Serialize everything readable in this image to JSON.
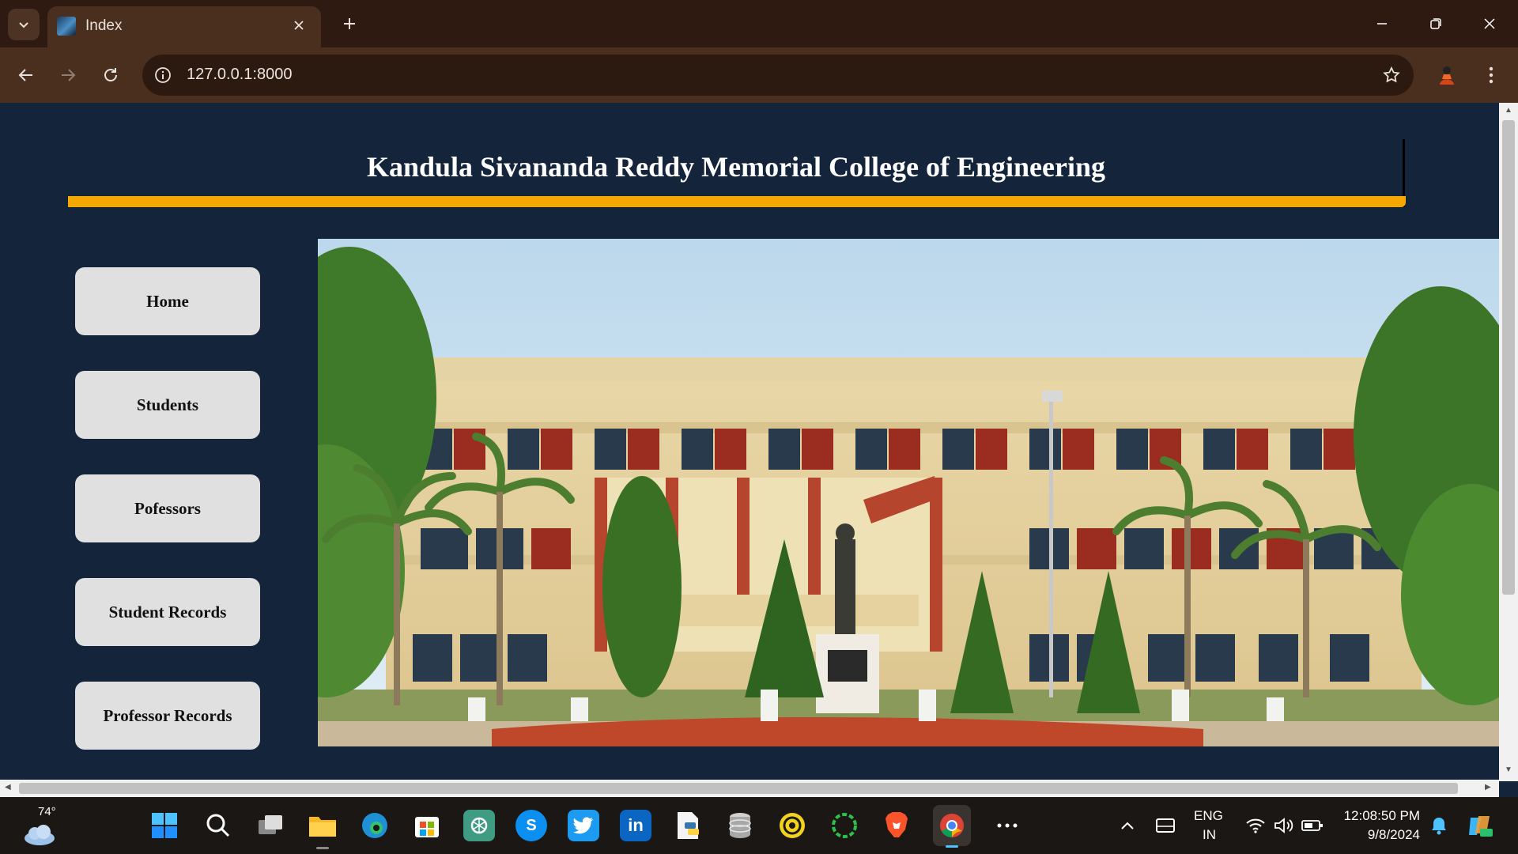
{
  "browser": {
    "tab_title": "Index",
    "url": "127.0.0.1:8000"
  },
  "page": {
    "title": "Kandula Sivananda Reddy Memorial College of Engineering",
    "nav": [
      {
        "label": "Home"
      },
      {
        "label": "Students"
      },
      {
        "label": "Pofessors"
      },
      {
        "label": "Student Records"
      },
      {
        "label": "Professor Records"
      }
    ],
    "hero_image": "college-building-photo"
  },
  "taskbar": {
    "weather_temp": "74°",
    "language": "ENG",
    "region": "IN",
    "time": "12:08:50 PM",
    "date": "9/8/2024"
  },
  "colors": {
    "page_bg": "#13243b",
    "accent_rule": "#f5a800",
    "chrome_bg": "#4a2f1f",
    "button_bg": "#e0e0e0"
  }
}
